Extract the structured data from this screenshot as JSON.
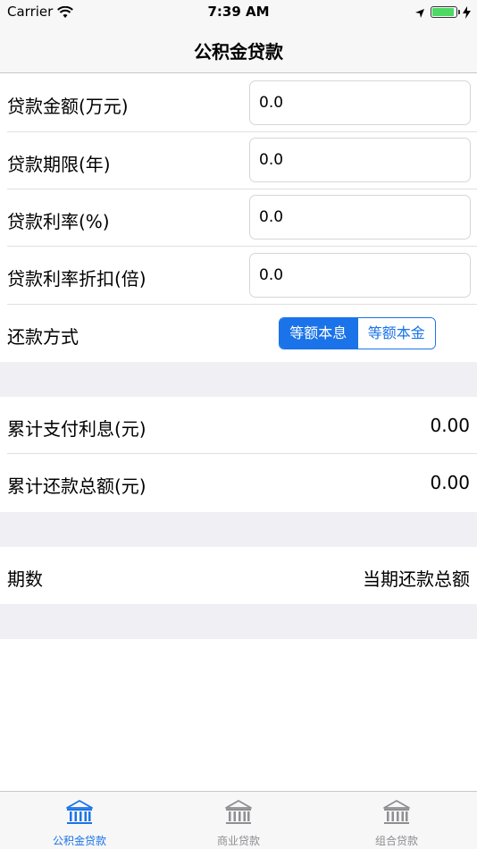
{
  "status_bar": {
    "carrier": "Carrier",
    "time": "7:39 AM"
  },
  "nav": {
    "title": "公积金贷款"
  },
  "form": {
    "rows": [
      {
        "label": "贷款金额(万元)",
        "value": "0.0"
      },
      {
        "label": "贷款期限(年)",
        "value": "0.0"
      },
      {
        "label": "贷款利率(%)",
        "value": "0.0"
      },
      {
        "label": "贷款利率折扣(倍)",
        "value": "0.0"
      }
    ],
    "repayment": {
      "label": "还款方式",
      "options": [
        "等额本息",
        "等额本金"
      ],
      "selected": "等额本息"
    }
  },
  "results": {
    "total_interest": {
      "label": "累计支付利息(元)",
      "value": "0.00"
    },
    "total_repayment": {
      "label": "累计还款总额(元)",
      "value": "0.00"
    }
  },
  "schedule": {
    "period_header": "期数",
    "amount_header": "当期还款总额"
  },
  "tab_bar": {
    "tabs": [
      {
        "label": "公积金贷款",
        "icon": "bank-icon",
        "active": true
      },
      {
        "label": "商业贷款",
        "icon": "bank-icon",
        "active": false
      },
      {
        "label": "组合贷款",
        "icon": "bank-icon",
        "active": false
      }
    ]
  },
  "colors": {
    "accent": "#1a73e8",
    "inactive_tab": "#8e8e93",
    "background_band": "#efeff4"
  }
}
